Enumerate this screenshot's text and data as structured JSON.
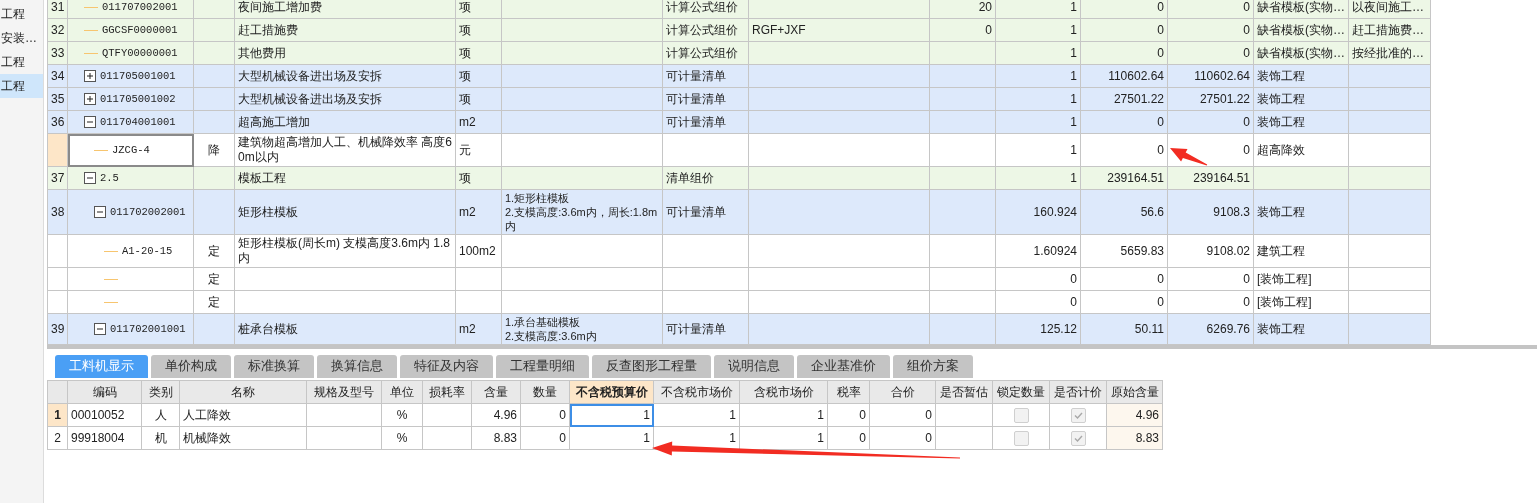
{
  "sidebar": {
    "items": [
      {
        "label": "工程",
        "selected": false
      },
      {
        "label": "安装…",
        "selected": false
      },
      {
        "label": "工程",
        "selected": false
      },
      {
        "label": "工程",
        "selected": true
      }
    ]
  },
  "item_table": {
    "rows": [
      {
        "number": "31",
        "code": "011707002001",
        "kind": "group",
        "selected": false,
        "cells": [
          null,
          "夜间施工增加费",
          "项",
          null,
          "计算公式组价",
          null,
          "20",
          "1",
          "0",
          "0",
          "缺省模板(实物…",
          "以夜间施工…"
        ]
      },
      {
        "number": "32",
        "code": "GGCSF0000001",
        "kind": "group",
        "selected": false,
        "cells": [
          null,
          "赶工措施费",
          "项",
          null,
          "计算公式组价",
          "RGF+JXF",
          "0",
          "1",
          "0",
          "0",
          "缺省模板(实物…",
          "赶工措施费…"
        ]
      },
      {
        "number": "33",
        "code": "QTFY00000001",
        "kind": "group",
        "selected": false,
        "cells": [
          null,
          "其他费用",
          "项",
          null,
          "计算公式组价",
          null,
          null,
          "1",
          "0",
          "0",
          "缺省模板(实物…",
          "按经批准的…"
        ]
      },
      {
        "number": "34",
        "code": "011705001001",
        "kind": "item",
        "selected": false,
        "expanded": false,
        "cells": [
          null,
          "大型机械设备进出场及安拆",
          "项",
          null,
          "可计量清单",
          null,
          null,
          "1",
          "110602.64",
          "110602.64",
          "装饰工程",
          null
        ]
      },
      {
        "number": "35",
        "code": "011705001002",
        "kind": "item",
        "selected": false,
        "expanded": false,
        "cells": [
          null,
          "大型机械设备进出场及安拆",
          "项",
          null,
          "可计量清单",
          null,
          null,
          "1",
          "27501.22",
          "27501.22",
          "装饰工程",
          null
        ]
      },
      {
        "number": "36",
        "code": "011704001001",
        "kind": "item",
        "selected": false,
        "expanded": true,
        "cells": [
          null,
          "超高施工增加",
          "m2",
          null,
          "可计量清单",
          null,
          null,
          "1",
          "0",
          "0",
          "装饰工程",
          null
        ],
        "children": [
          {
            "code": "JZCG-4",
            "kind": "quota",
            "selected": true,
            "cells": [
              "降",
              "建筑物超高增加人工、机械降效率 高度60m以内",
              "元",
              null,
              null,
              null,
              null,
              "1",
              "0",
              "0",
              "超高降效",
              null
            ]
          }
        ]
      },
      {
        "number": "37",
        "code": "2.5",
        "kind": "group",
        "selected": false,
        "expanded": true,
        "cells": [
          null,
          "模板工程",
          "项",
          null,
          "清单组价",
          null,
          null,
          "1",
          "239164.51",
          "239164.51",
          null,
          null
        ],
        "children": [
          {
            "number": "38",
            "code": "011702002001",
            "kind": "item",
            "selected": false,
            "expanded": true,
            "cells": [
              null,
              "矩形柱模板",
              "m2",
              "1.矩形柱模板\n2.支模高度:3.6m内，周长:1.8m内",
              "可计量清单",
              null,
              null,
              "160.924",
              "56.6",
              "9108.3",
              "装饰工程",
              null
            ],
            "children": [
              {
                "code": "A1-20-15",
                "kind": "quota",
                "selected": false,
                "cells": [
                  "定",
                  "矩形柱模板(周长m) 支模高度3.6m内 1.8内",
                  "100m2",
                  null,
                  null,
                  null,
                  null,
                  "1.60924",
                  "5659.83",
                  "9108.02",
                  "建筑工程",
                  null
                ]
              },
              {
                "kind": "quota",
                "selected": false,
                "cells": [
                  "定",
                  null,
                  null,
                  null,
                  null,
                  null,
                  null,
                  "0",
                  "0",
                  "0",
                  "[装饰工程]",
                  null
                ]
              },
              {
                "kind": "quota",
                "selected": false,
                "cells": [
                  "定",
                  null,
                  null,
                  null,
                  null,
                  null,
                  null,
                  "0",
                  "0",
                  "0",
                  "[装饰工程]",
                  null
                ]
              }
            ]
          },
          {
            "number": "39",
            "code": "011702001001",
            "kind": "item",
            "selected": false,
            "expanded": true,
            "cells": [
              null,
              "桩承台模板",
              "m2",
              "1.承台基础模板\n2.支模高度:3.6m内",
              "可计量清单",
              null,
              null,
              "125.12",
              "50.11",
              "6269.76",
              "装饰工程",
              null
            ]
          }
        ]
      }
    ]
  },
  "detail_tabs": [
    {
      "label": "工料机显示",
      "selected": true
    },
    {
      "label": "单价构成",
      "selected": false
    },
    {
      "label": "标准换算",
      "selected": false
    },
    {
      "label": "换算信息",
      "selected": false
    },
    {
      "label": "特征及内容",
      "selected": false
    },
    {
      "label": "工程量明细",
      "selected": false
    },
    {
      "label": "反查图形工程量",
      "selected": false
    },
    {
      "label": "说明信息",
      "selected": false
    },
    {
      "label": "企业基准价",
      "selected": false
    },
    {
      "label": "组价方案",
      "selected": false
    }
  ],
  "resource_table": {
    "columns": [
      {
        "label": "编码",
        "kind": "text",
        "selected": false
      },
      {
        "label": "类别",
        "kind": "center",
        "selected": false
      },
      {
        "label": "名称",
        "kind": "text",
        "selected": false
      },
      {
        "label": "规格及型号",
        "kind": "text",
        "selected": false
      },
      {
        "label": "单位",
        "kind": "center",
        "selected": false
      },
      {
        "label": "损耗率",
        "kind": "number",
        "selected": false
      },
      {
        "label": "含量",
        "kind": "number",
        "selected": false
      },
      {
        "label": "数量",
        "kind": "number",
        "selected": false
      },
      {
        "label": "不含税预算价",
        "kind": "number",
        "selected": true
      },
      {
        "label": "不含税市场价",
        "kind": "number",
        "selected": false
      },
      {
        "label": "含税市场价",
        "kind": "number",
        "selected": false
      },
      {
        "label": "税率",
        "kind": "number",
        "selected": false
      },
      {
        "label": "合价",
        "kind": "number",
        "selected": false
      },
      {
        "label": "是否暂估",
        "kind": "checkbox",
        "selected": false
      },
      {
        "label": "锁定数量",
        "kind": "checkbox",
        "selected": false
      },
      {
        "label": "是否计价",
        "kind": "checkbox",
        "selected": false
      },
      {
        "label": "原始含量",
        "kind": "shaded",
        "selected": false
      }
    ],
    "rows": [
      {
        "number": "1",
        "selected": true,
        "cells": [
          "00010052",
          "人",
          "人工降效",
          null,
          "%",
          null,
          "4.96",
          "0",
          "1",
          "1",
          "1",
          "0",
          "0",
          null,
          {
            "checked": false,
            "disabled": true
          },
          {
            "checked": true,
            "disabled": true
          },
          "4.96"
        ]
      },
      {
        "number": "2",
        "selected": false,
        "cells": [
          "99918004",
          "机",
          "机械降效",
          null,
          "%",
          null,
          "8.83",
          "0",
          "1",
          "1",
          "1",
          "0",
          "0",
          null,
          {
            "checked": false,
            "disabled": true
          },
          {
            "checked": true,
            "disabled": true
          },
          "8.83"
        ]
      }
    ]
  }
}
